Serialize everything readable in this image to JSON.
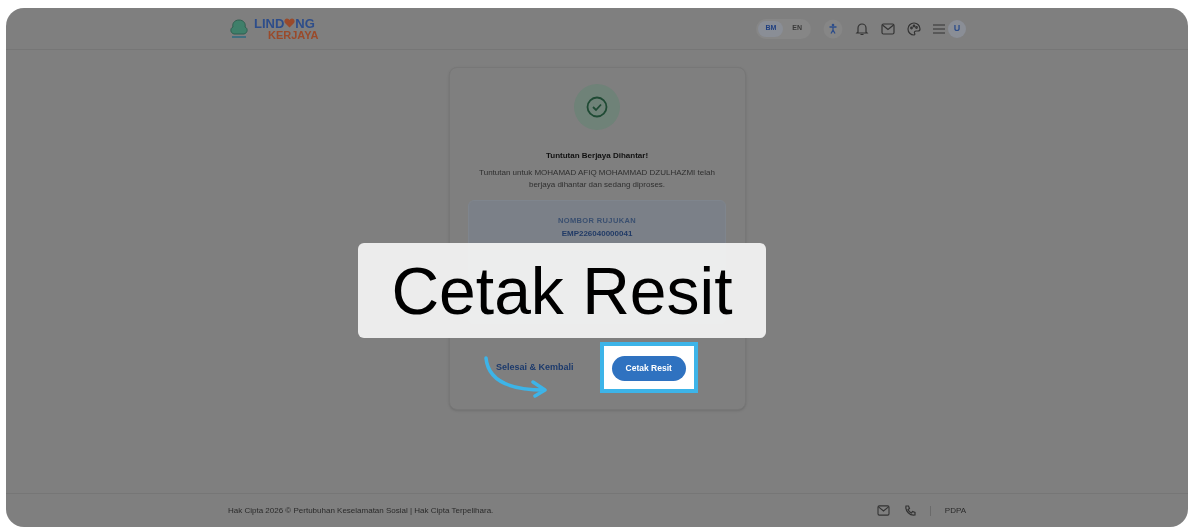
{
  "header": {
    "logo": {
      "text_before": "LIND",
      "text_after": "NG",
      "subtitle": "KERJAYA"
    },
    "languages": [
      {
        "label": "BM",
        "selected": true
      },
      {
        "label": "EN",
        "selected": false
      }
    ],
    "avatar": "U"
  },
  "card": {
    "title": "Tuntutan Berjaya Dihantar!",
    "message": "Tuntutan untuk MOHAMAD AFIQ MOHAMMAD DZULHAZMI telah berjaya dihantar dan sedang diproses.",
    "reference": {
      "label": "NOMBOR RUJUKAN",
      "value": "EMP226040000041"
    },
    "buttons": [
      {
        "kind": "link",
        "label": "Selesai & Kembali"
      },
      {
        "kind": "primary",
        "label": "Cetak Resit",
        "highlighted": true
      }
    ]
  },
  "callout": {
    "text": "Cetak Resit"
  },
  "footer": {
    "copyright": "Hak Cipta 2026 © Pertubuhan Keselamatan Sosial | Hak Cipta Terpelihara.",
    "link": "PDPA"
  }
}
